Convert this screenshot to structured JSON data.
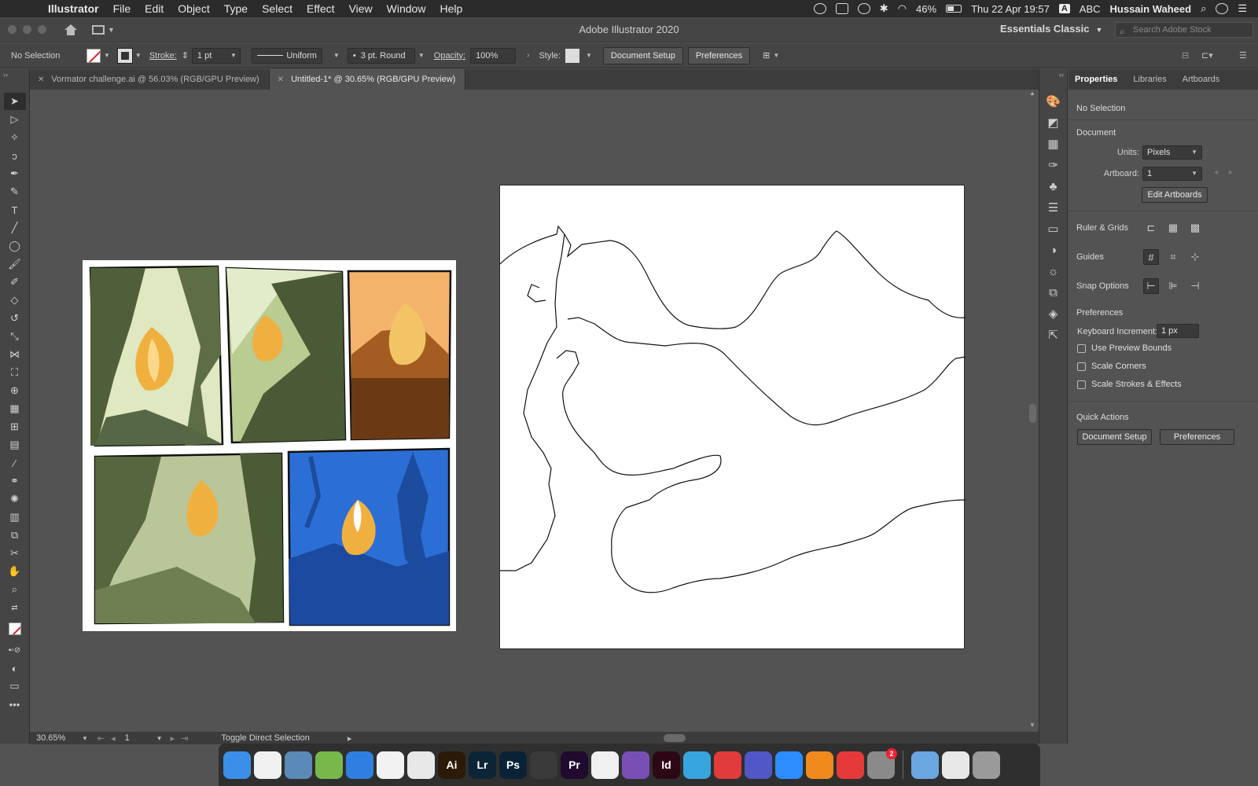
{
  "menubar": {
    "app_name": "Illustrator",
    "menus": [
      "File",
      "Edit",
      "Object",
      "Type",
      "Select",
      "Effect",
      "View",
      "Window",
      "Help"
    ],
    "battery": "46%",
    "keyboard": "ABC",
    "datetime": "Thu 22 Apr  19:57",
    "user": "Hussain Waheed"
  },
  "titlebar": {
    "title": "Adobe Illustrator 2020",
    "workspace": "Essentials Classic",
    "search_placeholder": "Search Adobe Stock"
  },
  "controlbar": {
    "selection": "No Selection",
    "stroke_label": "Stroke:",
    "stroke_value": "1 pt",
    "profile": "Uniform",
    "brush": "3 pt. Round",
    "opacity_label": "Opacity:",
    "opacity_value": "100%",
    "style_label": "Style:",
    "document_setup": "Document Setup",
    "preferences": "Preferences"
  },
  "doctabs": [
    {
      "label": "Vormator challenge.ai @ 56.03% (RGB/GPU Preview)",
      "active": false
    },
    {
      "label": "Untitled-1* @ 30.65% (RGB/GPU Preview)",
      "active": true
    }
  ],
  "panel": {
    "tabs": [
      "Properties",
      "Libraries",
      "Artboards"
    ],
    "selection": "No Selection",
    "document_heading": "Document",
    "units_label": "Units:",
    "units_value": "Pixels",
    "artboard_label": "Artboard:",
    "artboard_value": "1",
    "edit_artboards": "Edit Artboards",
    "ruler_grids": "Ruler & Grids",
    "guides": "Guides",
    "snap_options": "Snap Options",
    "preferences_heading": "Preferences",
    "keyboard_increment_label": "Keyboard Increment:",
    "keyboard_increment_value": "1 px",
    "checkboxes": [
      "Use Preview Bounds",
      "Scale Corners",
      "Scale Strokes & Effects"
    ],
    "quick_actions": "Quick Actions",
    "qa_document_setup": "Document Setup",
    "qa_preferences": "Preferences"
  },
  "statusbar": {
    "zoom": "30.65%",
    "page": "1",
    "message": "Toggle Direct Selection"
  },
  "dock": {
    "apps": [
      {
        "name": "finder-icon",
        "label": "",
        "color": "#3b8fe8"
      },
      {
        "name": "reminders-icon",
        "label": "",
        "color": "#f0f0f0"
      },
      {
        "name": "preview-icon",
        "label": "",
        "color": "#5a8ab8"
      },
      {
        "name": "android-studio-icon",
        "label": "",
        "color": "#78b84a"
      },
      {
        "name": "safari-icon",
        "label": "",
        "color": "#2f7fe0"
      },
      {
        "name": "sketchbook-icon",
        "label": "",
        "color": "#f2f2f2"
      },
      {
        "name": "chrome-icon",
        "label": "",
        "color": "#e8e8e8"
      },
      {
        "name": "illustrator-icon",
        "label": "Ai",
        "color": "#2a1a06"
      },
      {
        "name": "lightroom-icon",
        "label": "Lr",
        "color": "#0b2536"
      },
      {
        "name": "photoshop-icon",
        "label": "Ps",
        "color": "#0a2236"
      },
      {
        "name": "blender-icon",
        "label": "",
        "color": "#3a3a3a"
      },
      {
        "name": "premiere-icon",
        "label": "Pr",
        "color": "#200a2e"
      },
      {
        "name": "dock-app-icon",
        "label": "",
        "color": "#f0f0f0"
      },
      {
        "name": "viber-icon",
        "label": "",
        "color": "#7a4fb5"
      },
      {
        "name": "indesign-icon",
        "label": "Id",
        "color": "#2e0716"
      },
      {
        "name": "telegram-icon",
        "label": "",
        "color": "#37a5de"
      },
      {
        "name": "dock-app-red-icon",
        "label": "",
        "color": "#e23b3b"
      },
      {
        "name": "teams-icon",
        "label": "",
        "color": "#5058c8"
      },
      {
        "name": "zoom-icon",
        "label": "",
        "color": "#2d8cff"
      },
      {
        "name": "vlc-icon",
        "label": "",
        "color": "#f08a1c"
      },
      {
        "name": "creative-cloud-icon",
        "label": "",
        "color": "#e63a3a"
      },
      {
        "name": "system-preferences-icon",
        "label": "",
        "color": "#8a8a8a",
        "badge": "2"
      },
      {
        "name": "applications-folder-icon",
        "label": "",
        "color": "#6aa6e0"
      },
      {
        "name": "document-icon",
        "label": "",
        "color": "#e8e8e8"
      },
      {
        "name": "trash-icon",
        "label": "",
        "color": "#9a9a9a"
      }
    ]
  },
  "colors": {
    "panel_bg": "#535353",
    "chrome_bg": "#454545",
    "canvas_bg": "#535353",
    "artboard": "#ffffff",
    "forest_green": "#4f5f3a",
    "flame_orange": "#f0b040",
    "night_blue": "#2b6fd6",
    "sunset_orange": "#f4b36a"
  }
}
